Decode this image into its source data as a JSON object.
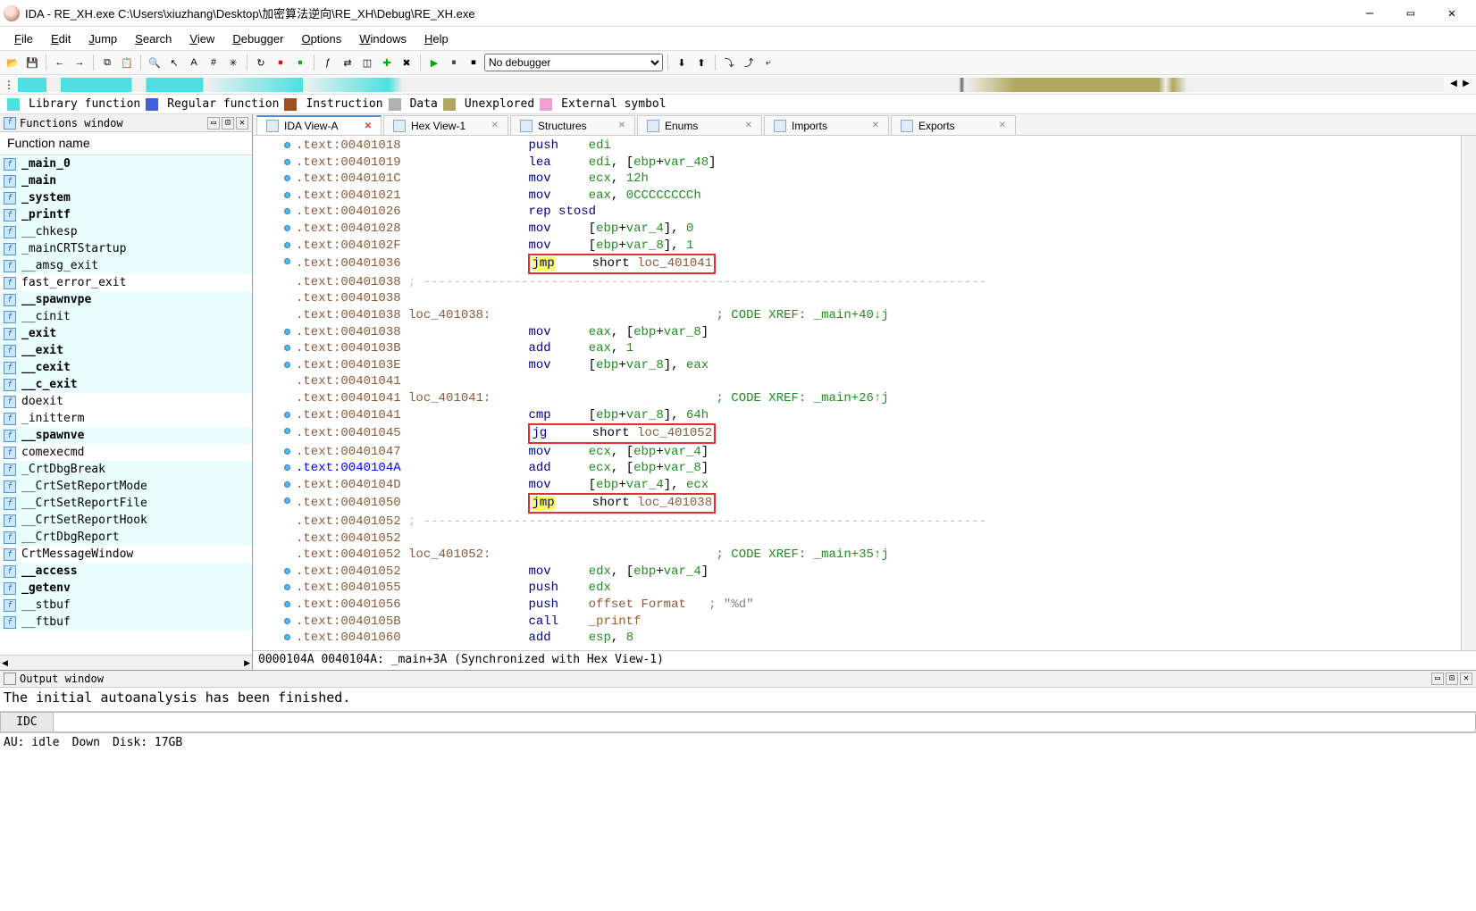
{
  "window": {
    "title": "IDA - RE_XH.exe C:\\Users\\xiuzhang\\Desktop\\加密算法逆向\\RE_XH\\Debug\\RE_XH.exe"
  },
  "menu": [
    "File",
    "Edit",
    "Jump",
    "Search",
    "View",
    "Debugger",
    "Options",
    "Windows",
    "Help"
  ],
  "debugger_combo": "No debugger",
  "legend": [
    {
      "color": "#4de0e0",
      "label": "Library function"
    },
    {
      "color": "#4060e0",
      "label": "Regular function"
    },
    {
      "color": "#a05020",
      "label": "Instruction"
    },
    {
      "color": "#b0b0b0",
      "label": "Data"
    },
    {
      "color": "#b0a860",
      "label": "Unexplored"
    },
    {
      "color": "#f0a0d0",
      "label": "External symbol"
    }
  ],
  "functions_window": {
    "title": "Functions window",
    "header": "Function name",
    "items": [
      {
        "name": "_main_0",
        "bold": true,
        "hl": true
      },
      {
        "name": "_main",
        "bold": true,
        "hl": true
      },
      {
        "name": "_system",
        "bold": true,
        "hl": true
      },
      {
        "name": "_printf",
        "bold": true,
        "hl": true
      },
      {
        "name": "__chkesp",
        "hl": true
      },
      {
        "name": "_mainCRTStartup",
        "hl": true
      },
      {
        "name": "__amsg_exit",
        "hl": true
      },
      {
        "name": "fast_error_exit",
        "hl": false
      },
      {
        "name": "__spawnvpe",
        "bold": true,
        "hl": true
      },
      {
        "name": "__cinit",
        "hl": true
      },
      {
        "name": "_exit",
        "bold": true,
        "hl": true
      },
      {
        "name": "__exit",
        "bold": true,
        "hl": true
      },
      {
        "name": "__cexit",
        "bold": true,
        "hl": true
      },
      {
        "name": "__c_exit",
        "bold": true,
        "hl": true
      },
      {
        "name": "doexit",
        "hl": false
      },
      {
        "name": "_initterm",
        "hl": false
      },
      {
        "name": "__spawnve",
        "bold": true,
        "hl": true
      },
      {
        "name": "comexecmd",
        "hl": false
      },
      {
        "name": "_CrtDbgBreak",
        "hl": true
      },
      {
        "name": "__CrtSetReportMode",
        "hl": true
      },
      {
        "name": "__CrtSetReportFile",
        "hl": true
      },
      {
        "name": "__CrtSetReportHook",
        "hl": true
      },
      {
        "name": "__CrtDbgReport",
        "hl": true
      },
      {
        "name": "CrtMessageWindow",
        "hl": false
      },
      {
        "name": "__access",
        "bold": true,
        "hl": true
      },
      {
        "name": "_getenv",
        "bold": true,
        "hl": true
      },
      {
        "name": "__stbuf",
        "hl": true
      },
      {
        "name": "__ftbuf",
        "hl": true
      }
    ]
  },
  "tabs": [
    {
      "label": "IDA View-A",
      "active": true,
      "close": "red"
    },
    {
      "label": "Hex View-1"
    },
    {
      "label": "Structures"
    },
    {
      "label": "Enums"
    },
    {
      "label": "Imports"
    },
    {
      "label": "Exports"
    }
  ],
  "disasm_status": "0000104A 0040104A: _main+3A (Synchronized with Hex View-1)",
  "output": {
    "title": "Output window",
    "text": "The initial autoanalysis has been finished."
  },
  "cmd_label": "IDC",
  "statusbar": {
    "au": "AU:  idle",
    "down": "Down",
    "disk": "Disk: 17GB"
  },
  "lines": [
    {
      "dot": 1,
      "addr": ".text:00401018",
      "ins": "push",
      "op": "<r>edi</r>"
    },
    {
      "dot": 1,
      "addr": ".text:00401019",
      "ins": "lea",
      "op": "<r>edi</r>, [<r>ebp</r>+<v>var_48</v>]"
    },
    {
      "dot": 1,
      "addr": ".text:0040101C",
      "ins": "mov",
      "op": "<r>ecx</r>, <n>12h</n>"
    },
    {
      "dot": 1,
      "addr": ".text:00401021",
      "ins": "mov",
      "op": "<r>eax</r>, <n>0CCCCCCCCh</n>"
    },
    {
      "dot": 1,
      "addr": ".text:00401026",
      "ins": "rep stosd",
      "op": ""
    },
    {
      "dot": 1,
      "addr": ".text:00401028",
      "ins": "mov",
      "op": "[<r>ebp</r>+<v>var_4</v>], <n>0</n>"
    },
    {
      "dot": 1,
      "addr": ".text:0040102F",
      "ins": "mov",
      "op": "[<r>ebp</r>+<v>var_8</v>], <n>1</n>"
    },
    {
      "dot": 1,
      "addr": ".text:00401036",
      "box": 1,
      "inshl": "jmp",
      "op": "short <l>loc_401041</l>"
    },
    {
      "addr": ".text:00401038",
      "dash": 1,
      "op": "; ---------------------------------------------------------------------------"
    },
    {
      "addr": ".text:00401038"
    },
    {
      "addr": ".text:00401038",
      "label": "loc_401038:",
      "xref": "; CODE XREF: _main+40↓j"
    },
    {
      "dot": 1,
      "addr": ".text:00401038",
      "ins": "mov",
      "op": "<r>eax</r>, [<r>ebp</r>+<v>var_8</v>]"
    },
    {
      "dot": 1,
      "addr": ".text:0040103B",
      "ins": "add",
      "op": "<r>eax</r>, <n>1</n>"
    },
    {
      "dot": 1,
      "addr": ".text:0040103E",
      "ins": "mov",
      "op": "[<r>ebp</r>+<v>var_8</v>], <r>eax</r>"
    },
    {
      "addr": ".text:00401041"
    },
    {
      "addr": ".text:00401041",
      "label": "loc_401041:",
      "xref": "; CODE XREF: _main+26↑j"
    },
    {
      "dot": 1,
      "addr": ".text:00401041",
      "ins": "cmp",
      "op": "[<r>ebp</r>+<v>var_8</v>], <n>64h</n>"
    },
    {
      "dot": 1,
      "addr": ".text:00401045",
      "box": 1,
      "ins": "jg",
      "op": "short <l>loc_401052</l>"
    },
    {
      "dot": 1,
      "addr": ".text:00401047",
      "ins": "mov",
      "op": "<r>ecx</r>, [<r>ebp</r>+<v>var_4</v>]"
    },
    {
      "dot": 1,
      "addr": ".text:0040104A",
      "blue": 1,
      "ins": "add",
      "op": "<r>ecx</r>, [<r>ebp</r>+<v>var_8</v>]"
    },
    {
      "dot": 1,
      "addr": ".text:0040104D",
      "ins": "mov",
      "op": "[<r>ebp</r>+<v>var_4</v>], <r>ecx</r>"
    },
    {
      "dot": 1,
      "addr": ".text:00401050",
      "box": 1,
      "inshl": "jmp",
      "op": "short <l>loc_401038</l>"
    },
    {
      "addr": ".text:00401052",
      "dash": 1,
      "op": "; ---------------------------------------------------------------------------"
    },
    {
      "addr": ".text:00401052"
    },
    {
      "addr": ".text:00401052",
      "label": "loc_401052:",
      "xref": "; CODE XREF: _main+35↑j"
    },
    {
      "dot": 1,
      "addr": ".text:00401052",
      "ins": "mov",
      "op": "<r>edx</r>, [<r>ebp</r>+<v>var_4</v>]"
    },
    {
      "dot": 1,
      "addr": ".text:00401055",
      "ins": "push",
      "op": "<r>edx</r>"
    },
    {
      "dot": 1,
      "addr": ".text:00401056",
      "ins": "push",
      "op": "<l>offset Format</l>   <s>; \"%d\"</s>"
    },
    {
      "dot": 1,
      "addr": ".text:0040105B",
      "ins": "call",
      "op": "<c>_printf</c>"
    },
    {
      "dot": 1,
      "addr": ".text:00401060",
      "ins": "add",
      "op": "<r>esp</r>, <n>8</n>"
    }
  ]
}
